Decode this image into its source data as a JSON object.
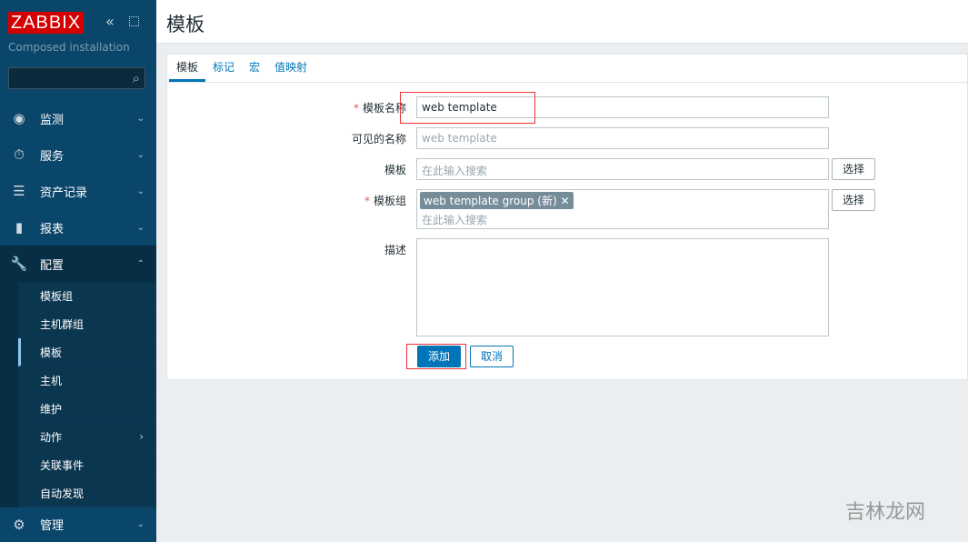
{
  "sidebar": {
    "logo": "ZABBIX",
    "subtitle": "Composed installation",
    "search_placeholder": "",
    "menu": [
      {
        "label": "监测",
        "icon": "eye-icon"
      },
      {
        "label": "服务",
        "icon": "stopwatch-icon"
      },
      {
        "label": "资产记录",
        "icon": "list-icon"
      },
      {
        "label": "报表",
        "icon": "bar-chart-icon"
      },
      {
        "label": "配置",
        "icon": "wrench-icon"
      },
      {
        "label": "管理",
        "icon": "gear-icon"
      }
    ],
    "submenu": [
      "模板组",
      "主机群组",
      "模板",
      "主机",
      "维护",
      "动作",
      "关联事件",
      "自动发现"
    ]
  },
  "header": {
    "title": "模板"
  },
  "tabs": [
    "模板",
    "标记",
    "宏",
    "值映射"
  ],
  "form": {
    "name_label": "模板名称",
    "name_value": "web template",
    "visible_label": "可见的名称",
    "visible_placeholder": "web template",
    "templates_label": "模板",
    "templates_placeholder": "在此输入搜索",
    "select_label": "选择",
    "groups_label": "模板组",
    "group_tag": "web template group (新)",
    "groups_placeholder": "在此输入搜索",
    "desc_label": "描述",
    "required_mark": "*",
    "add": "添加",
    "cancel": "取消"
  },
  "watermark": "吉林龙网",
  "colors": {
    "accent": "#0275b8",
    "sidebar": "#0a466a",
    "logo": "#d40000"
  }
}
